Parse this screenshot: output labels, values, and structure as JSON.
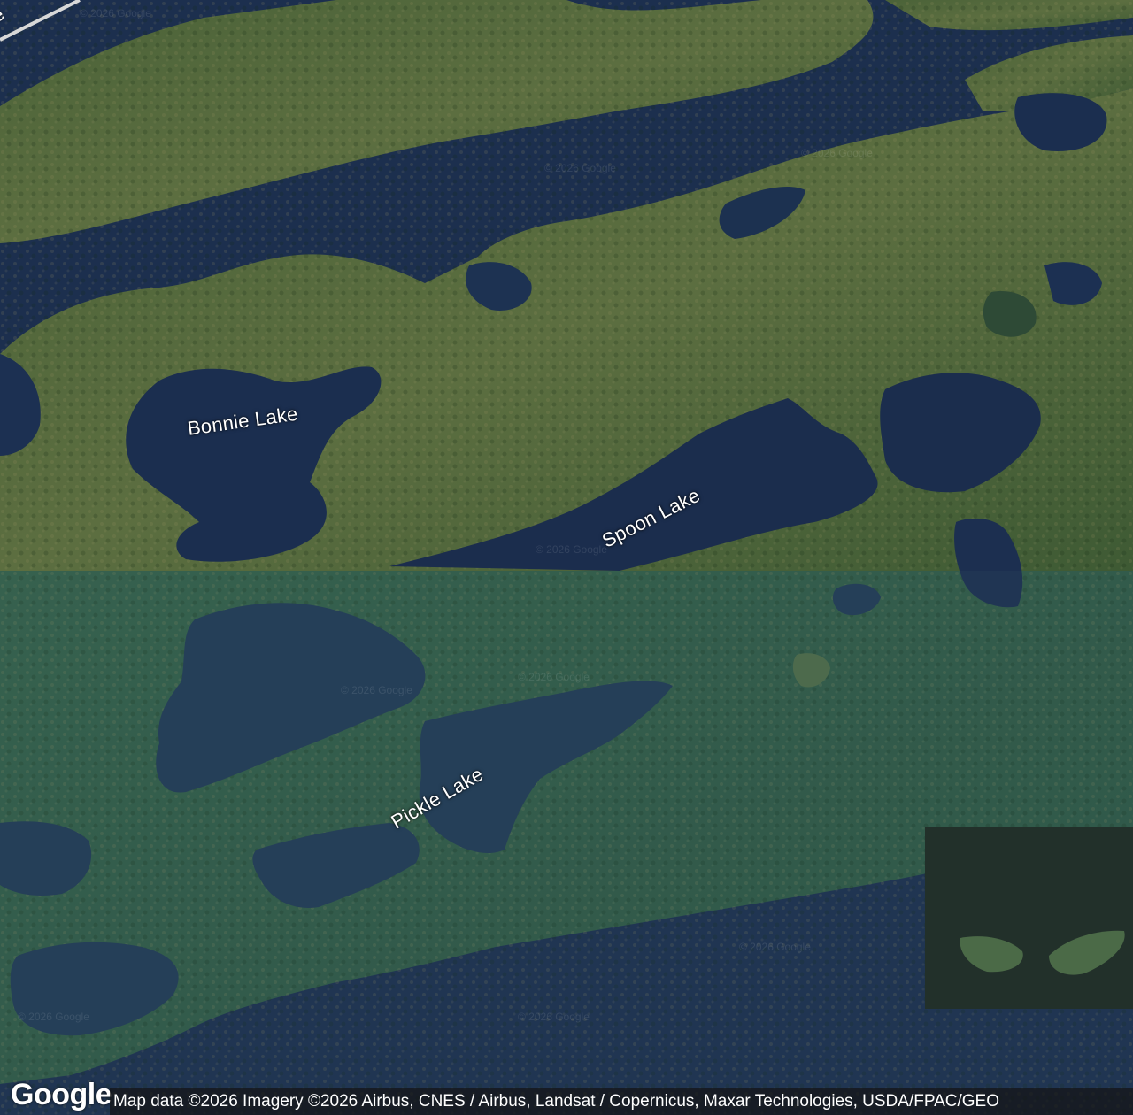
{
  "map": {
    "type": "satellite",
    "labels": {
      "bonnie": "Bonnie Lake",
      "spoon": "Spoon Lake",
      "pickle": "Pickle Lake",
      "road_fragment": "e"
    },
    "watermark": "© 2026 Google",
    "logo": "Google",
    "attribution": "Map data ©2026 Imagery ©2026 Airbus, CNES / Airbus, Landsat / Copernicus, Maxar Technologies, USDA/FPAC/GEO"
  },
  "colors": {
    "water": "#1c2f4e",
    "forest_top": "#3f5a32",
    "forest_bottom": "#2f5a48",
    "label_text": "#ffffff"
  }
}
